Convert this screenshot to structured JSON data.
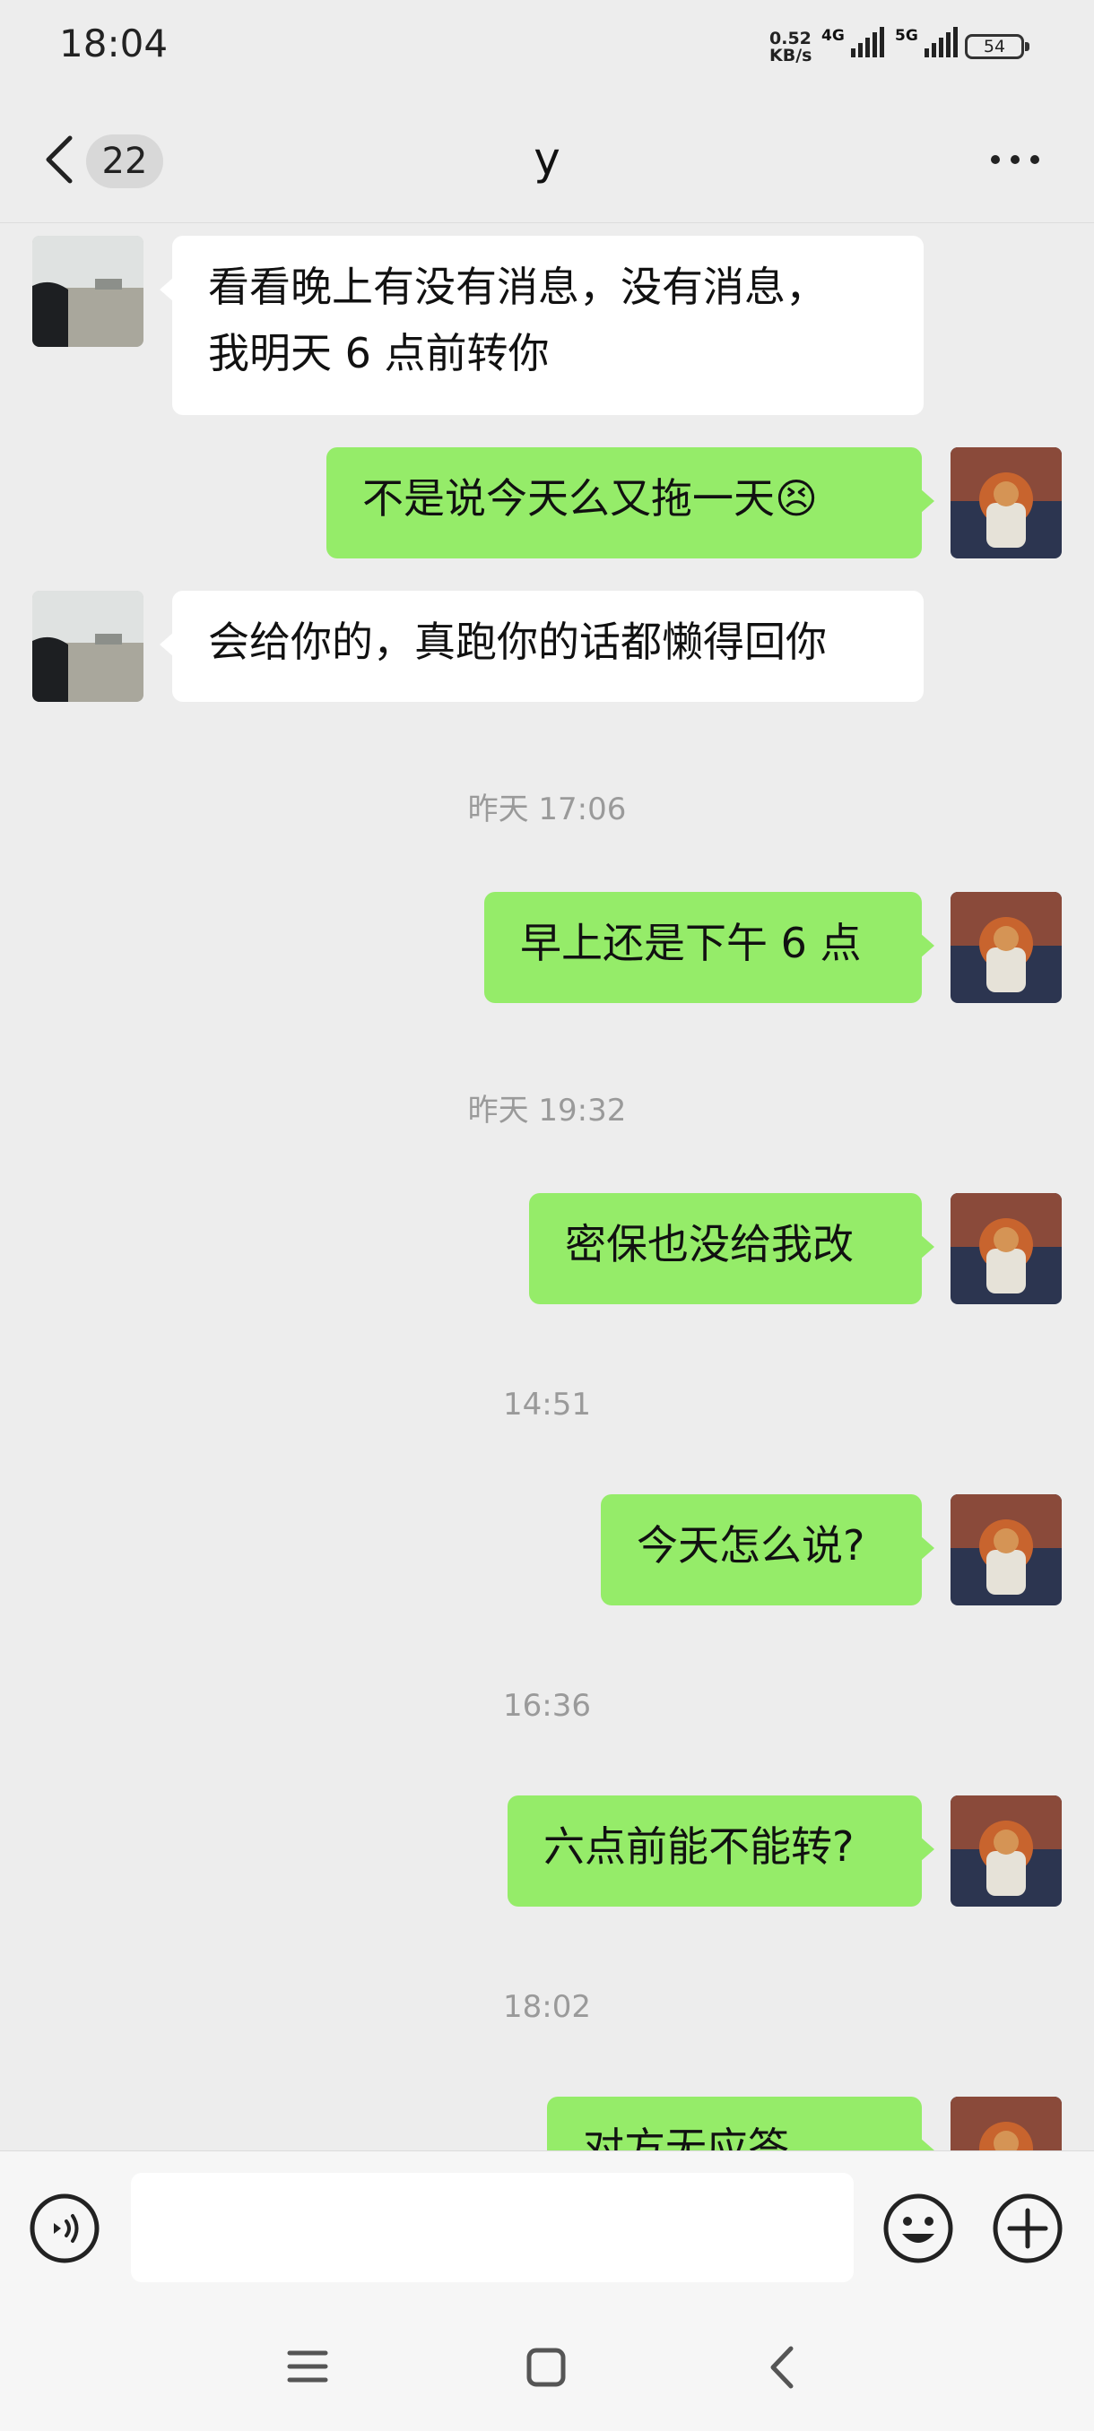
{
  "status_bar": {
    "time": "18:04",
    "network_speed_value": "0.52",
    "network_speed_unit": "KB/s",
    "signal1_label": "4G",
    "signal2_label": "5G",
    "battery": "54"
  },
  "header": {
    "unread_count": "22",
    "title": "y"
  },
  "messages": [
    {
      "type": "in",
      "text_line1": "看看晚上有没有消息，没有消息，",
      "text_line2": "我明天 6 点前转你"
    },
    {
      "type": "out",
      "text": "不是说今天么又拖一天",
      "emoji": "😣"
    },
    {
      "type": "in",
      "text": "会给你的，真跑你的话都懒得回你"
    },
    {
      "type": "time",
      "text": "昨天 17:06"
    },
    {
      "type": "out",
      "text": "早上还是下午 6 点"
    },
    {
      "type": "time",
      "text": "昨天 19:32"
    },
    {
      "type": "out",
      "text": "密保也没给我改"
    },
    {
      "type": "time",
      "text": "14:51"
    },
    {
      "type": "out",
      "text": "今天怎么说?"
    },
    {
      "type": "time",
      "text": "16:36"
    },
    {
      "type": "out",
      "text": "六点前能不能转?"
    },
    {
      "type": "time",
      "text": "18:02"
    },
    {
      "type": "out",
      "text": "对方无应答"
    }
  ],
  "input_bar": {
    "voice_icon": "voice-icon",
    "emoji_icon": "emoji-icon",
    "plus_icon": "plus-icon",
    "input_value": ""
  },
  "colors": {
    "background": "#ededed",
    "outgoing_bubble": "#95ec69",
    "incoming_bubble": "#ffffff",
    "timestamp_text": "#9a9a9a"
  }
}
